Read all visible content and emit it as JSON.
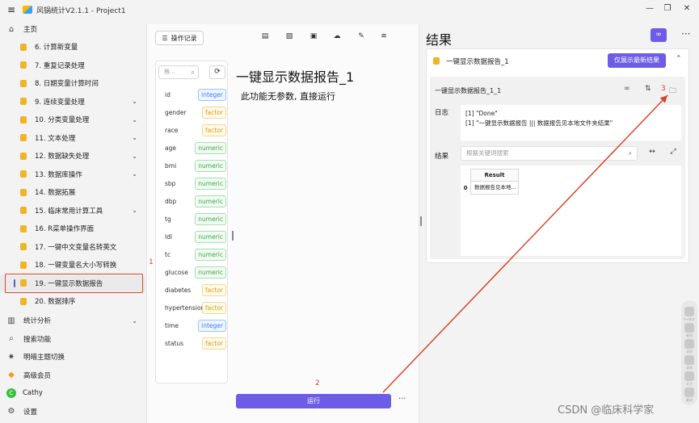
{
  "app": {
    "title": "风锅统计V2.1.1 - Project1",
    "menu_icon": "hamburger-icon"
  },
  "sidebar": {
    "home": "主页",
    "items": [
      {
        "label": "6. 计算新变量",
        "chev": ""
      },
      {
        "label": "7. 重复记录处理",
        "chev": ""
      },
      {
        "label": "8. 日期变量计算时间",
        "chev": ""
      },
      {
        "label": "9. 连续变量处理",
        "chev": "⌄"
      },
      {
        "label": "10. 分类变量处理",
        "chev": "⌄"
      },
      {
        "label": "11. 文本处理",
        "chev": "⌄"
      },
      {
        "label": "12. 数据缺失处理",
        "chev": "⌄"
      },
      {
        "label": "13. 数据库操作",
        "chev": "⌄"
      },
      {
        "label": "14. 数据拓展",
        "chev": ""
      },
      {
        "label": "15. 临床常用计算工具",
        "chev": "⌄"
      },
      {
        "label": "16. R菜单操作界面",
        "chev": ""
      },
      {
        "label": "17. 一键中文变量名转英文",
        "chev": ""
      },
      {
        "label": "18. 一键变量名大小写转换",
        "chev": ""
      },
      {
        "label": "19. 一键显示数据报告",
        "chev": ""
      },
      {
        "label": "20. 数据排序",
        "chev": ""
      }
    ],
    "bottom": {
      "stats": "统计分析",
      "search": "搜索功能",
      "theme": "明暗主题切换",
      "vip": "高级会员",
      "user": "Cathy",
      "user_initial": "C",
      "settings": "设置"
    }
  },
  "annotations": {
    "one": "1",
    "two": "2",
    "three": "3"
  },
  "middle": {
    "log_button": "操作记录",
    "search_placeholder": "根...",
    "title": "一键显示数据报告_1",
    "subtitle": "此功能无参数, 直接运行",
    "run_button": "运行",
    "more": "···",
    "variables": [
      {
        "name": "id",
        "type": "integer"
      },
      {
        "name": "gender",
        "type": "factor"
      },
      {
        "name": "race",
        "type": "factor"
      },
      {
        "name": "age",
        "type": "numeric"
      },
      {
        "name": "bmi",
        "type": "numeric"
      },
      {
        "name": "sbp",
        "type": "numeric"
      },
      {
        "name": "dbp",
        "type": "numeric"
      },
      {
        "name": "tg",
        "type": "numeric"
      },
      {
        "name": "ldl",
        "type": "numeric"
      },
      {
        "name": "tc",
        "type": "numeric"
      },
      {
        "name": "glucose",
        "type": "numeric"
      },
      {
        "name": "diabetes",
        "type": "factor"
      },
      {
        "name": "hypertension",
        "type": "factor"
      },
      {
        "name": "time",
        "type": "integer"
      },
      {
        "name": "status",
        "type": "factor"
      }
    ]
  },
  "results": {
    "title": "结果",
    "more": "···",
    "card_title": "一键显示数据报告_1",
    "latest_button": "仅展示最新结果",
    "inner_title": "一键显示数据报告_1_1",
    "log_label": "日志",
    "log_lines": [
      "[1] \"Done\"",
      "[1] \"一键显示数据报告 ||| 数据报告见本地文件夹结果\""
    ],
    "result_label": "结果",
    "search_placeholder": "根据关键词搜索",
    "table": {
      "header": "Result",
      "index": "0",
      "cell": "数据报告见本地..."
    }
  },
  "float_bar": [
    "A+移字",
    "截图",
    "录屏",
    "录像",
    "文字",
    "翻译"
  ],
  "watermark": "CSDN @临床科学家",
  "colors": {
    "accent": "#6c5ce7",
    "annotation": "#d9452c",
    "db_icon": "#f0b429"
  }
}
